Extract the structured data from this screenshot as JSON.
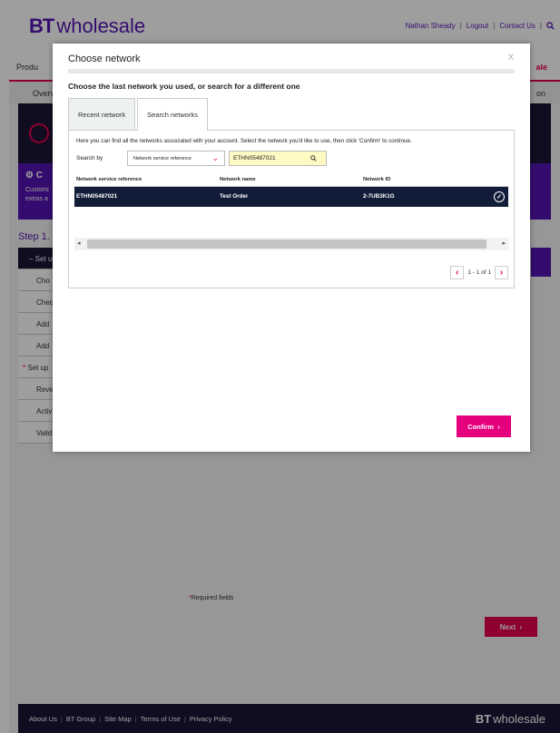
{
  "header": {
    "logo_bt": "BT",
    "logo_text": "wholesale",
    "user": "Nathan Sheady",
    "logout": "Logout",
    "contact": "Contact Us",
    "sep": "|"
  },
  "nav": {
    "left_item": "Produ",
    "right_item": "ale"
  },
  "band": {
    "left_item": "Overv",
    "right_item": "on"
  },
  "purple_box": {
    "title": "C",
    "line1": "Customi",
    "line2": "extras a"
  },
  "step_title": "Step 1. C",
  "steps": [
    "Set up",
    "Cho",
    "Chec",
    "Add",
    "Add",
    "Set up",
    "Revie",
    "Activ",
    "Valid"
  ],
  "required": {
    "asterisk": "*",
    "text": "Required fields"
  },
  "next_label": "Next",
  "footer": {
    "links": [
      "About Us",
      "BT Group",
      "Site Map",
      "Terms of Use",
      "Privacy Policy"
    ],
    "sep": "|",
    "logo_bt": "BT",
    "logo_text": "wholesale"
  },
  "modal": {
    "title": "Choose network",
    "close": "X",
    "subtitle": "Choose the last network you used, or search for a different one",
    "tabs": [
      {
        "label": "Recent network",
        "active": false
      },
      {
        "label": "Search networks",
        "active": true
      }
    ],
    "description": "Here you can find all the networks associated with your account. Select the network you'd like to use, then click 'Confirm' to continue.",
    "search_by_label": "Search by",
    "search_by_value": "Network service reference",
    "search_value": "ETHN05487021",
    "columns": [
      "Network service reference",
      "Network name",
      "Network ID"
    ],
    "rows": [
      {
        "ref": "ETHN05487021",
        "name": "Test Order",
        "id": "2-7UB3K1G",
        "selected": true
      }
    ],
    "pagination": "1 - 1 of 1",
    "confirm_label": "Confirm"
  },
  "colors": {
    "brand_purple": "#5514b4",
    "accent_pink": "#e6007e",
    "dark_navy": "#111d38"
  }
}
